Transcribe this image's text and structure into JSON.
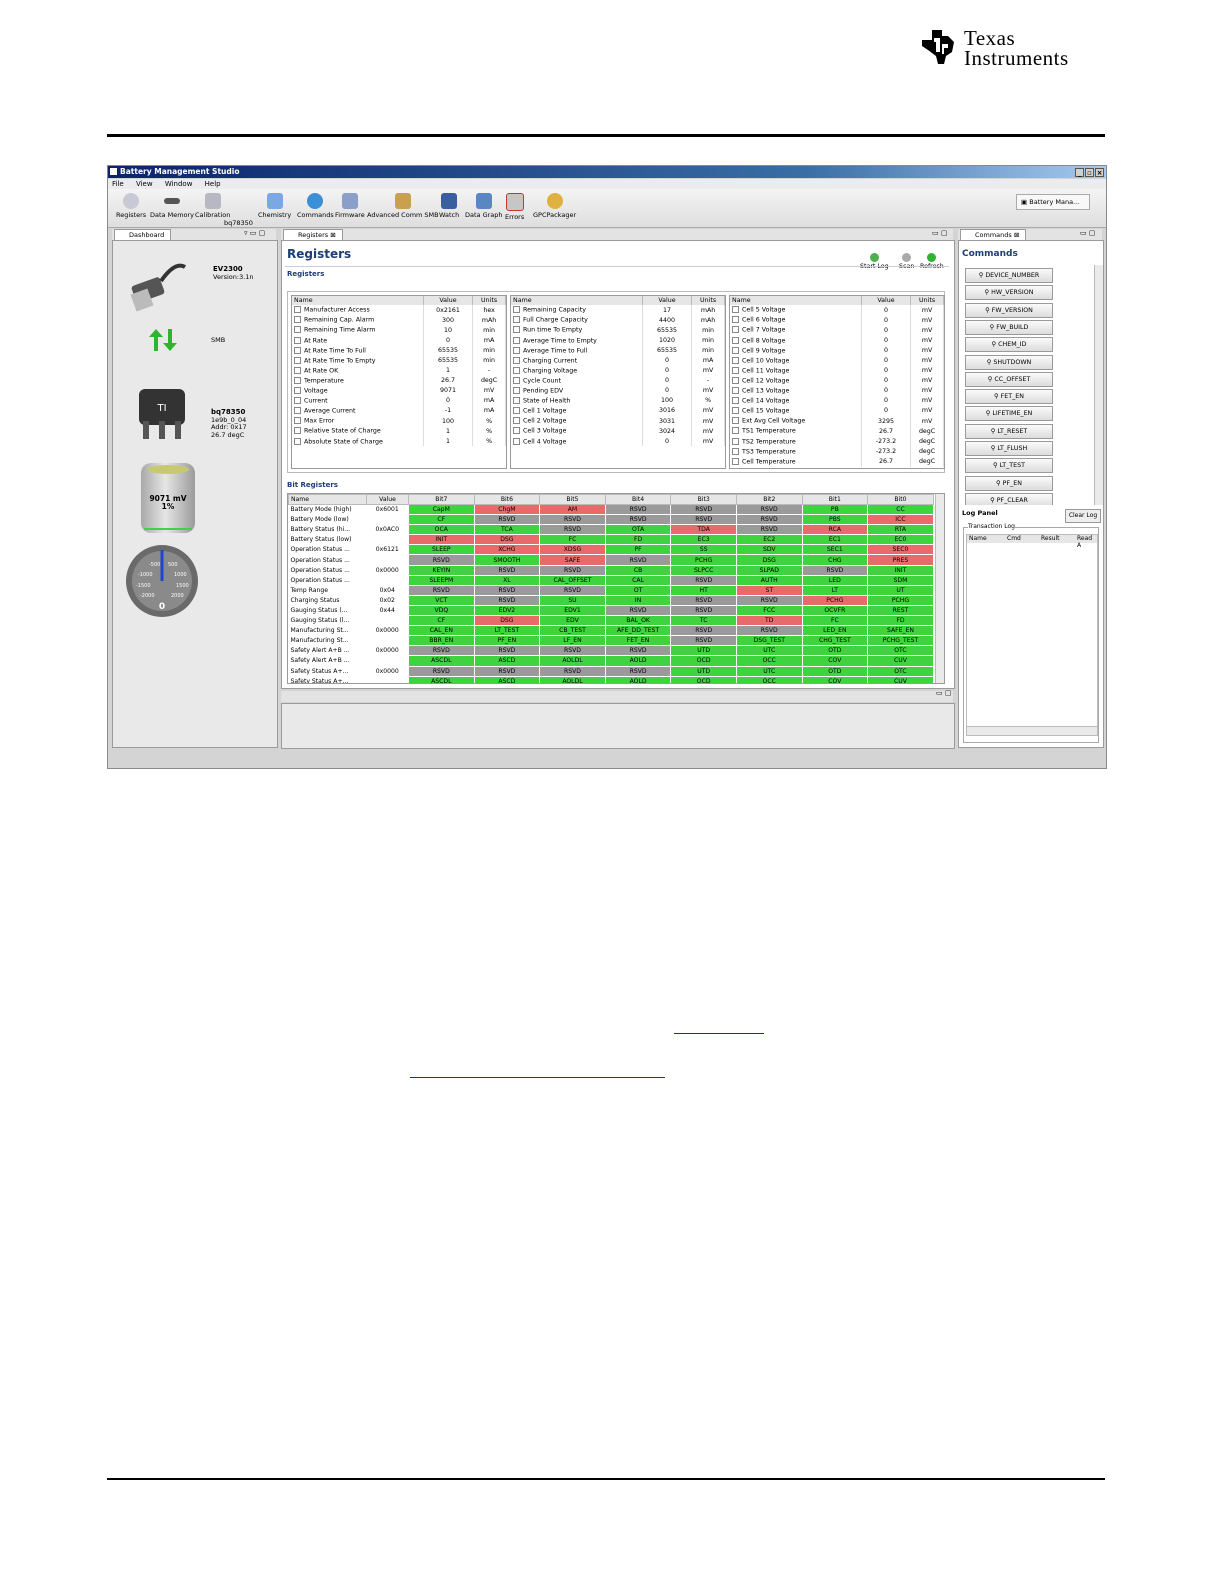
{
  "logo": {
    "line1": "Texas",
    "line2": "Instruments"
  },
  "app": {
    "title": "Battery Management Studio",
    "menu": [
      "File",
      "View",
      "Window",
      "Help"
    ],
    "toolbar": [
      "Registers",
      "Data Memory",
      "Calibration",
      "bq78350",
      "Chemistry",
      "Commands",
      "Firmware",
      "Advanced Comm SMB",
      "Watch",
      "Data Graph",
      "Errors",
      "GPCPackager"
    ],
    "perspective": "Battery Mana...",
    "colors": {
      "ok": "#3fd43f",
      "alert": "#e86b6b",
      "reserved": "#9a9a9a",
      "heading": "#1d3e74"
    }
  },
  "dashboard": {
    "tab": "Dashboard",
    "device": "EV2300",
    "version": "Version:3.1n",
    "bus": "SMB",
    "gauge_name": "bq78350",
    "fw": "1e9b_0_04",
    "addr": "Addr: 0x17",
    "temp": "26.7 degC",
    "battery_voltage": "9071 mV",
    "battery_pct": "1%",
    "battery_level": 0.01,
    "meter_ticks": [
      "-500",
      "500",
      "-1000",
      "1000",
      "-1500",
      "1500",
      "-2000",
      "2000"
    ],
    "meter_value": "0"
  },
  "registers": {
    "tab": "Registers",
    "title": "Registers",
    "section": "Registers",
    "bit_section": "Bit Registers",
    "buttons": [
      "Start Log",
      "Scan",
      "Refresh"
    ],
    "headers": [
      "Name",
      "Value",
      "Units"
    ],
    "table1": [
      [
        "Manufacturer Access",
        "0x2161",
        "hex"
      ],
      [
        "Remaining Cap. Alarm",
        "300",
        "mAh"
      ],
      [
        "Remaining Time Alarm",
        "10",
        "min"
      ],
      [
        "At Rate",
        "0",
        "mA"
      ],
      [
        "At Rate Time To Full",
        "65535",
        "min"
      ],
      [
        "At Rate Time To Empty",
        "65535",
        "min"
      ],
      [
        "At Rate OK",
        "1",
        "-"
      ],
      [
        "Temperature",
        "26.7",
        "degC"
      ],
      [
        "Voltage",
        "9071",
        "mV"
      ],
      [
        "Current",
        "0",
        "mA"
      ],
      [
        "Average Current",
        "-1",
        "mA"
      ],
      [
        "Max Error",
        "100",
        "%"
      ],
      [
        "Relative State of Charge",
        "1",
        "%"
      ],
      [
        "Absolute State of Charge",
        "1",
        "%"
      ]
    ],
    "table2": [
      [
        "Remaining Capacity",
        "17",
        "mAh"
      ],
      [
        "Full Charge Capacity",
        "4400",
        "mAh"
      ],
      [
        "Run time To Empty",
        "65535",
        "min"
      ],
      [
        "Average Time to Empty",
        "1020",
        "min"
      ],
      [
        "Average Time to Full",
        "65535",
        "min"
      ],
      [
        "Charging Current",
        "0",
        "mA"
      ],
      [
        "Charging Voltage",
        "0",
        "mV"
      ],
      [
        "Cycle Count",
        "0",
        "-"
      ],
      [
        "Pending EDV",
        "0",
        "mV"
      ],
      [
        "State of Health",
        "100",
        "%"
      ],
      [
        "Cell 1 Voltage",
        "3016",
        "mV"
      ],
      [
        "Cell 2 Voltage",
        "3031",
        "mV"
      ],
      [
        "Cell 3 Voltage",
        "3024",
        "mV"
      ],
      [
        "Cell 4 Voltage",
        "0",
        "mV"
      ]
    ],
    "table3": [
      [
        "Cell 5 Voltage",
        "0",
        "mV"
      ],
      [
        "Cell 6 Voltage",
        "0",
        "mV"
      ],
      [
        "Cell 7 Voltage",
        "0",
        "mV"
      ],
      [
        "Cell 8 Voltage",
        "0",
        "mV"
      ],
      [
        "Cell 9 Voltage",
        "0",
        "mV"
      ],
      [
        "Cell 10 Voltage",
        "0",
        "mV"
      ],
      [
        "Cell 11 Voltage",
        "0",
        "mV"
      ],
      [
        "Cell 12 Voltage",
        "0",
        "mV"
      ],
      [
        "Cell 13 Voltage",
        "0",
        "mV"
      ],
      [
        "Cell 14 Voltage",
        "0",
        "mV"
      ],
      [
        "Cell 15 Voltage",
        "0",
        "mV"
      ],
      [
        "Ext Avg Cell Voltage",
        "3295",
        "mV"
      ],
      [
        "TS1 Temperature",
        "26.7",
        "degC"
      ],
      [
        "TS2 Temperature",
        "-273.2",
        "degC"
      ],
      [
        "TS3 Temperature",
        "-273.2",
        "degC"
      ],
      [
        "Cell Temperature",
        "26.7",
        "degC"
      ]
    ],
    "bit_headers": [
      "Name",
      "Value",
      "Bit7",
      "Bit6",
      "Bit5",
      "Bit4",
      "Bit3",
      "Bit2",
      "Bit1",
      "Bit0"
    ],
    "bit_rows": [
      {
        "name": "Battery Mode (high)",
        "value": "0x6001",
        "bits": [
          [
            "CapM",
            "g"
          ],
          [
            "ChgM",
            "r"
          ],
          [
            "AM",
            "r"
          ],
          [
            "RSVD",
            "y"
          ],
          [
            "RSVD",
            "y"
          ],
          [
            "RSVD",
            "y"
          ],
          [
            "PB",
            "g"
          ],
          [
            "CC",
            "g"
          ]
        ]
      },
      {
        "name": "Battery Mode (low)",
        "value": "",
        "bits": [
          [
            "CF",
            "g"
          ],
          [
            "RSVD",
            "y"
          ],
          [
            "RSVD",
            "y"
          ],
          [
            "RSVD",
            "y"
          ],
          [
            "RSVD",
            "y"
          ],
          [
            "RSVD",
            "y"
          ],
          [
            "PBS",
            "g"
          ],
          [
            "ICC",
            "r"
          ]
        ]
      },
      {
        "name": "Battery Status (hi...",
        "value": "0x0AC0",
        "bits": [
          [
            "OCA",
            "g"
          ],
          [
            "TCA",
            "g"
          ],
          [
            "RSVD",
            "y"
          ],
          [
            "OTA",
            "g"
          ],
          [
            "TDA",
            "r"
          ],
          [
            "RSVD",
            "y"
          ],
          [
            "RCA",
            "r"
          ],
          [
            "RTA",
            "g"
          ]
        ]
      },
      {
        "name": "Battery Status (low)",
        "value": "",
        "bits": [
          [
            "INIT",
            "r"
          ],
          [
            "DSG",
            "r"
          ],
          [
            "FC",
            "g"
          ],
          [
            "FD",
            "g"
          ],
          [
            "EC3",
            "g"
          ],
          [
            "EC2",
            "g"
          ],
          [
            "EC1",
            "g"
          ],
          [
            "EC0",
            "g"
          ]
        ]
      },
      {
        "name": "Operation Status ...",
        "value": "0x6121",
        "bits": [
          [
            "SLEEP",
            "g"
          ],
          [
            "XCHG",
            "r"
          ],
          [
            "XDSG",
            "r"
          ],
          [
            "PF",
            "g"
          ],
          [
            "SS",
            "g"
          ],
          [
            "SDV",
            "g"
          ],
          [
            "SEC1",
            "g"
          ],
          [
            "SEC0",
            "r"
          ]
        ]
      },
      {
        "name": "Operation Status ...",
        "value": "",
        "bits": [
          [
            "RSVD",
            "y"
          ],
          [
            "SMOOTH",
            "g"
          ],
          [
            "SAFE",
            "r"
          ],
          [
            "RSVD",
            "y"
          ],
          [
            "PCHG",
            "g"
          ],
          [
            "DSG",
            "g"
          ],
          [
            "CHG",
            "g"
          ],
          [
            "PRES",
            "r"
          ]
        ]
      },
      {
        "name": "Operation Status ...",
        "value": "0x0000",
        "bits": [
          [
            "KEYIN",
            "g"
          ],
          [
            "RSVD",
            "y"
          ],
          [
            "RSVD",
            "y"
          ],
          [
            "CB",
            "g"
          ],
          [
            "SLPCC",
            "g"
          ],
          [
            "SLPAD",
            "g"
          ],
          [
            "RSVD",
            "y"
          ],
          [
            "INIT",
            "g"
          ]
        ]
      },
      {
        "name": "Operation Status ...",
        "value": "",
        "bits": [
          [
            "SLEEPM",
            "g"
          ],
          [
            "XL",
            "g"
          ],
          [
            "CAL_OFFSET",
            "g"
          ],
          [
            "CAL",
            "g"
          ],
          [
            "RSVD",
            "y"
          ],
          [
            "AUTH",
            "g"
          ],
          [
            "LED",
            "g"
          ],
          [
            "SDM",
            "g"
          ]
        ]
      },
      {
        "name": "Temp Range",
        "value": "0x04",
        "bits": [
          [
            "RSVD",
            "y"
          ],
          [
            "RSVD",
            "y"
          ],
          [
            "RSVD",
            "y"
          ],
          [
            "OT",
            "g"
          ],
          [
            "HT",
            "g"
          ],
          [
            "ST",
            "r"
          ],
          [
            "LT",
            "g"
          ],
          [
            "UT",
            "g"
          ]
        ]
      },
      {
        "name": "Charging Status",
        "value": "0x02",
        "bits": [
          [
            "VCT",
            "g"
          ],
          [
            "RSVD",
            "y"
          ],
          [
            "SU",
            "g"
          ],
          [
            "IN",
            "g"
          ],
          [
            "RSVD",
            "y"
          ],
          [
            "RSVD",
            "y"
          ],
          [
            "PCHG",
            "r"
          ],
          [
            "PCHG",
            "g"
          ]
        ]
      },
      {
        "name": "Gauging Status (...",
        "value": "0x44",
        "bits": [
          [
            "VDQ",
            "g"
          ],
          [
            "EDV2",
            "g"
          ],
          [
            "EDV1",
            "g"
          ],
          [
            "RSVD",
            "y"
          ],
          [
            "RSVD",
            "y"
          ],
          [
            "FCC",
            "g"
          ],
          [
            "OCVFR",
            "g"
          ],
          [
            "REST",
            "g"
          ]
        ]
      },
      {
        "name": "Gauging Status (l...",
        "value": "",
        "bits": [
          [
            "CF",
            "g"
          ],
          [
            "DSG",
            "r"
          ],
          [
            "EDV",
            "g"
          ],
          [
            "BAL_OK",
            "g"
          ],
          [
            "TC",
            "g"
          ],
          [
            "TD",
            "r"
          ],
          [
            "FC",
            "g"
          ],
          [
            "FD",
            "g"
          ]
        ]
      },
      {
        "name": "Manufacturing St...",
        "value": "0x0000",
        "bits": [
          [
            "CAL_EN",
            "g"
          ],
          [
            "LT_TEST",
            "g"
          ],
          [
            "CB_TEST",
            "g"
          ],
          [
            "AFE_DD_TEST",
            "g"
          ],
          [
            "RSVD",
            "y"
          ],
          [
            "RSVD",
            "y"
          ],
          [
            "LED_EN",
            "g"
          ],
          [
            "SAFE_EN",
            "g"
          ]
        ]
      },
      {
        "name": "Manufacturing St...",
        "value": "",
        "bits": [
          [
            "BBR_EN",
            "g"
          ],
          [
            "PF_EN",
            "g"
          ],
          [
            "LF_EN",
            "g"
          ],
          [
            "FET_EN",
            "g"
          ],
          [
            "RSVD",
            "y"
          ],
          [
            "DSG_TEST",
            "g"
          ],
          [
            "CHG_TEST",
            "g"
          ],
          [
            "PCHG_TEST",
            "g"
          ]
        ]
      },
      {
        "name": "Safety Alert A+B ...",
        "value": "0x0000",
        "bits": [
          [
            "RSVD",
            "y"
          ],
          [
            "RSVD",
            "y"
          ],
          [
            "RSVD",
            "y"
          ],
          [
            "RSVD",
            "y"
          ],
          [
            "UTD",
            "g"
          ],
          [
            "UTC",
            "g"
          ],
          [
            "OTD",
            "g"
          ],
          [
            "OTC",
            "g"
          ]
        ]
      },
      {
        "name": "Safety Alert A+B ...",
        "value": "",
        "bits": [
          [
            "ASCDL",
            "g"
          ],
          [
            "ASCD",
            "g"
          ],
          [
            "AOLDL",
            "g"
          ],
          [
            "AOLD",
            "g"
          ],
          [
            "OCD",
            "g"
          ],
          [
            "OCC",
            "g"
          ],
          [
            "COV",
            "g"
          ],
          [
            "CUV",
            "g"
          ]
        ]
      },
      {
        "name": "Safety Status A+...",
        "value": "0x0000",
        "bits": [
          [
            "RSVD",
            "y"
          ],
          [
            "RSVD",
            "y"
          ],
          [
            "RSVD",
            "y"
          ],
          [
            "RSVD",
            "y"
          ],
          [
            "UTD",
            "g"
          ],
          [
            "UTC",
            "g"
          ],
          [
            "OTD",
            "g"
          ],
          [
            "OTC",
            "g"
          ]
        ]
      },
      {
        "name": "Safety Status A+...",
        "value": "",
        "bits": [
          [
            "ASCDL",
            "g"
          ],
          [
            "ASCD",
            "g"
          ],
          [
            "AOLDL",
            "g"
          ],
          [
            "AOLD",
            "g"
          ],
          [
            "OCD",
            "g"
          ],
          [
            "OCC",
            "g"
          ],
          [
            "COV",
            "g"
          ],
          [
            "CUV",
            "g"
          ]
        ]
      }
    ]
  },
  "commands": {
    "tab": "Commands",
    "title": "Commands",
    "items": [
      "DEVICE_NUMBER",
      "HW_VERSION",
      "FW_VERSION",
      "FW_BUILD",
      "CHEM_ID",
      "SHUTDOWN",
      "CC_OFFSET",
      "FET_EN",
      "LIFETIME_EN",
      "LT_RESET",
      "LT_FLUSH",
      "LT_TEST",
      "PF_EN",
      "PF_CLEAR"
    ],
    "log_panel": "Log Panel",
    "clear_log": "Clear Log",
    "transaction_log": "Transaction Log",
    "log_headers": [
      "Name",
      "Cmd",
      "Result",
      "Read A"
    ]
  }
}
